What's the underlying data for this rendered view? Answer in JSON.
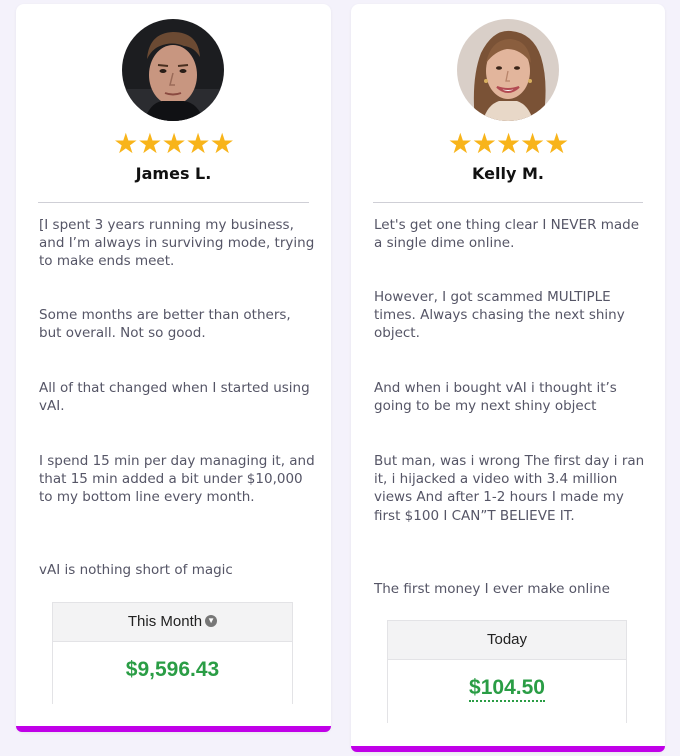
{
  "colors": {
    "accent_bar": "#c000e8",
    "star": "#f8b41a",
    "amount_green": "#2a9d45"
  },
  "cards": [
    {
      "stars": "★★★★★",
      "rating": 5,
      "name": "James L.",
      "paragraphs": [
        "[I spent 3 years running my business, and I’m always in surviving mode, trying to make ends meet.",
        "Some months are better than others, but overall. Not so good.",
        "All of that changed when I started using vAI.",
        "I spend 15 min per day managing it, and that 15 min added a bit under $10,000 to my bottom line every month.",
        "vAI is nothing short of magic"
      ],
      "widget": {
        "label": "This Month",
        "amount": "$9,596.43",
        "icon": "chevron-down-icon"
      }
    },
    {
      "stars": "★★★★★",
      "rating": 5,
      "name": "Kelly M.",
      "paragraphs": [
        "Let's get one thing clear I NEVER made a single dime online.",
        "However, I got scammed MULTIPLE times. Always chasing the next shiny object.",
        "And when i bought vAI i thought it’s going to be my next shiny object",
        "But man, was i wrong The first day i ran it, i hijacked a video with 3.4 million views  And after 1-2 hours I made my first $100 I CAN”T BELIEVE IT.",
        "The first money I ever make online"
      ],
      "widget": {
        "label": "Today",
        "amount": "$104.50"
      }
    }
  ]
}
